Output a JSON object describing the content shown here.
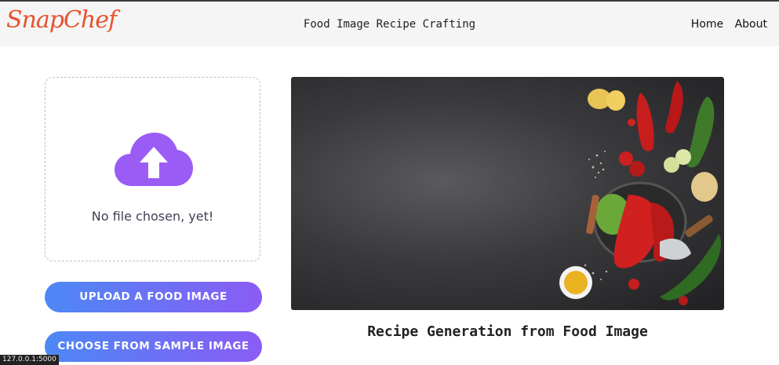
{
  "navbar": {
    "brand": "SnapChef",
    "title": "Food Image Recipe Crafting",
    "links": [
      "Home",
      "About"
    ]
  },
  "upload": {
    "status_text": "No file chosen, yet!",
    "upload_button": "UPLOAD A FOOD IMAGE",
    "sample_button": "CHOOSE FROM SAMPLE IMAGE"
  },
  "hero": {
    "caption": "Recipe Generation from Food Image"
  },
  "status_bar": {
    "url": "127.0.0.1:5000"
  },
  "colors": {
    "brand": "#e8522e",
    "upload_icon": "#9b5cf6",
    "button_start": "#4c88f5",
    "button_end": "#8a5cf5"
  }
}
